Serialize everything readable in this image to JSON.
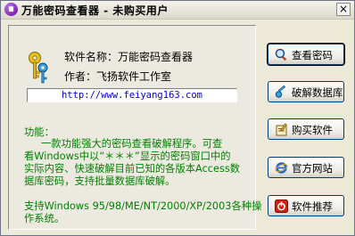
{
  "window": {
    "title": "万能密码查看器 - 未购买用户",
    "close_glyph": "×"
  },
  "info": {
    "software_name": "软件名称：万能密码查看器",
    "author": "作者：飞扬软件工作室",
    "url": "http://www.feiyang163.com"
  },
  "description": {
    "heading": "功能：",
    "lines": [
      "一款功能强大的密码查看破解程序。可查",
      "看Windows中以“＊＊＊”显示的密码窗口中的",
      "实际内容、快速破解目前已知的各版本Access数",
      "据库密码，支持批量数据库破解。"
    ],
    "support_lines": [
      "支持Windows 95/98/ME/NT/2000/XP/2003各种操",
      "作系统。"
    ]
  },
  "buttons": [
    {
      "label": "查看密码",
      "icon": "magnifier-icon"
    },
    {
      "label": "破解数据库",
      "icon": "key-icon"
    },
    {
      "label": "购买软件",
      "icon": "notepad-icon"
    },
    {
      "label": "官方网站",
      "icon": "ie-icon"
    },
    {
      "label": "软件推荐",
      "icon": "power-icon"
    }
  ]
}
